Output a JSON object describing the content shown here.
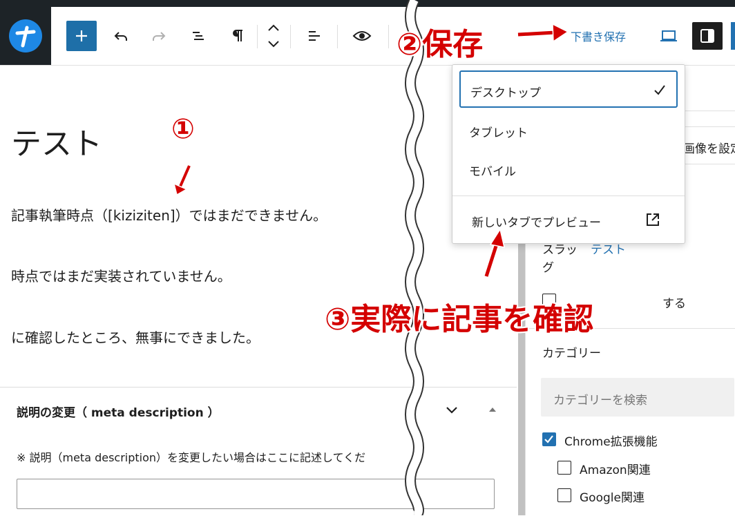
{
  "toolbar": {
    "save_draft_label": "下書き保存"
  },
  "editor": {
    "title": "テスト",
    "paragraphs": [
      "記事執筆時点（[kiziziten]）ではまだできません。",
      "時点ではまだ実装されていません。",
      "に確認したところ、無事にできました。"
    ]
  },
  "meta_box": {
    "title": "説明の変更（ meta description ）",
    "note": "※ 説明（meta description）を変更したい場合はここに記述してくだ",
    "input_value": ""
  },
  "preview_menu": {
    "items": [
      "デスクトップ",
      "タブレット",
      "モバイル"
    ],
    "selected": "デスクトップ",
    "new_tab_label": "新しいタブでプレビュー"
  },
  "sidebar": {
    "featured_image_fragment": "画像を設定",
    "slug_label_1": "スラッ",
    "slug_label_2": "グ",
    "slug_value": "テスト",
    "pin_fragment": "する",
    "categories_heading": "カテゴリー",
    "category_search_placeholder": "カテゴリーを検索",
    "categories": [
      {
        "label": "Chrome拡張機能",
        "checked": true
      },
      {
        "label": "Amazon関連",
        "checked": false
      },
      {
        "label": "Google関連",
        "checked": false
      }
    ]
  },
  "annotations": {
    "step1": "①",
    "step2": "②保存",
    "step3": "③実際に記事を確認"
  },
  "colors": {
    "accent": "#2271b1",
    "annotation": "#d40000",
    "dark": "#1d2327"
  }
}
